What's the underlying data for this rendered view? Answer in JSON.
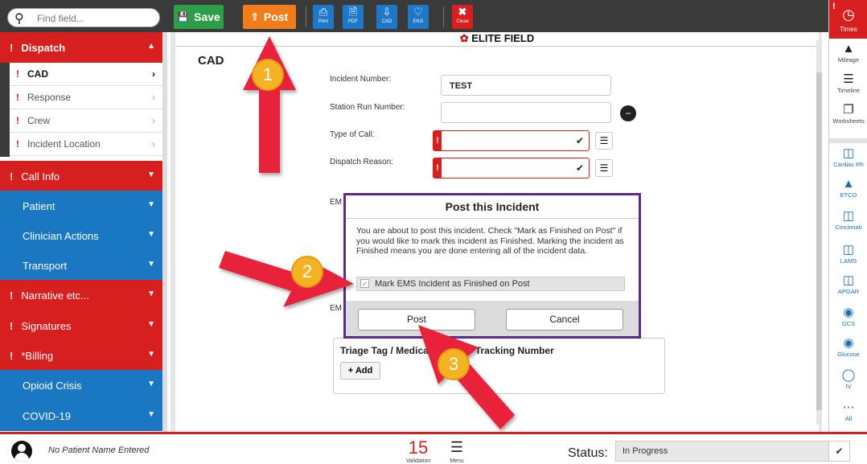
{
  "toolbar": {
    "search_placeholder": "Find field...",
    "save_label": "Save",
    "post_label": "Post",
    "print_label": "Print",
    "pdf_label": "PDF",
    "cad_label": "CAD",
    "ekg_label": "EKG",
    "close_label": "Close"
  },
  "sidebar": {
    "dispatch_label": "Dispatch",
    "sub_items": [
      {
        "label": "CAD"
      },
      {
        "label": "Response"
      },
      {
        "label": "Crew"
      },
      {
        "label": "Incident Location"
      }
    ],
    "sections": [
      {
        "label": "Call Info",
        "color": "red",
        "required": true
      },
      {
        "label": "Patient",
        "color": "blue",
        "required": false
      },
      {
        "label": "Clinician Actions",
        "color": "blue",
        "required": false
      },
      {
        "label": "Transport",
        "color": "blue",
        "required": false
      },
      {
        "label": "Narrative etc...",
        "color": "red",
        "required": true
      },
      {
        "label": "Signatures",
        "color": "red",
        "required": true
      },
      {
        "label": "*Billing",
        "color": "red",
        "required": true
      },
      {
        "label": "Opioid Crisis",
        "color": "blue",
        "required": false
      },
      {
        "label": "COVID-19",
        "color": "blue",
        "required": false
      }
    ]
  },
  "main": {
    "brand": "ELITE FIELD",
    "page_title": "CAD",
    "fields": {
      "incident_number_label": "Incident Number:",
      "incident_number_value": "TEST",
      "station_run_label": "Station Run Number:",
      "type_of_call_label": "Type of Call:",
      "dispatch_reason_label": "Dispatch Reason:",
      "em_label_1": "EM",
      "em_label_2": "EM"
    },
    "triage_title": "Triage Tag / Medical Record / Tracking Number",
    "add_label": "Add"
  },
  "dialog": {
    "title": "Post this Incident",
    "body": "You are about to post this incident. Check \"Mark as Finished on Post\" if you would like to mark this incident as Finished. Marking the incident as Finished means you are done entering all of the incident data.",
    "checkbox_label": "Mark EMS Incident as Finished on Post",
    "checkbox_checked": true,
    "post_button": "Post",
    "cancel_button": "Cancel"
  },
  "right_bar": {
    "items": [
      {
        "label": "Times",
        "icon": "clock-icon"
      },
      {
        "label": "Mileage",
        "icon": "road-icon"
      },
      {
        "label": "Timeline",
        "icon": "sliders-icon"
      },
      {
        "label": "Worksheets",
        "icon": "copy-icon"
      },
      {
        "label": "Cardiac Rh",
        "icon": "medkit-icon"
      },
      {
        "label": "ETCO",
        "icon": "lungs-icon"
      },
      {
        "label": "Cincinnati",
        "icon": "medkit-icon"
      },
      {
        "label": "LAMS",
        "icon": "medkit-icon"
      },
      {
        "label": "APGAR",
        "icon": "medkit-icon"
      },
      {
        "label": "GCS",
        "icon": "eye-icon"
      },
      {
        "label": "Glucose",
        "icon": "drop-icon"
      },
      {
        "label": "IV",
        "icon": "iv-icon"
      },
      {
        "label": "All",
        "icon": "dots-icon"
      }
    ]
  },
  "bottom": {
    "patient_name": "No Patient Name Entered",
    "validation_count": "15",
    "validation_label": "Validation",
    "menu_label": "Menu",
    "status_label": "Status:",
    "status_value": "In Progress"
  },
  "annotations": {
    "step1": "1",
    "step2": "2",
    "step3": "3"
  },
  "colors": {
    "accent_red": "#d81f1f",
    "accent_blue": "#1a78c2",
    "post_orange": "#f07d1a",
    "save_green": "#2e9e48",
    "dialog_border": "#5b2a8e",
    "annotation_arrow": "#e8213a",
    "annotation_circle": "#f5b323"
  }
}
